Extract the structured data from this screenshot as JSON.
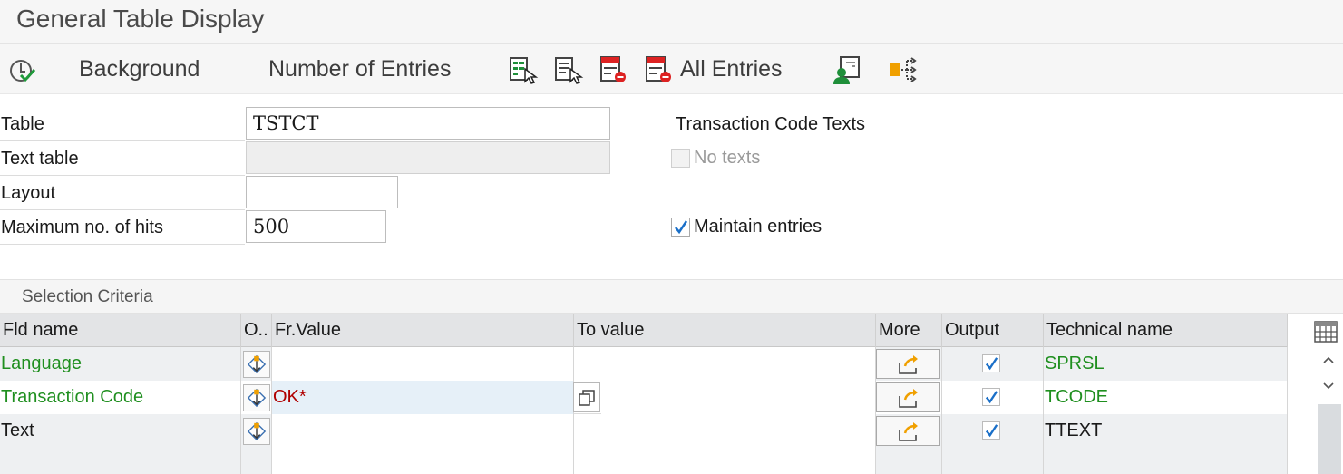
{
  "window": {
    "title": "General Table Display"
  },
  "toolbar": {
    "background_label": "Background",
    "number_of_entries_label": "Number of Entries",
    "all_entries_label": "All Entries"
  },
  "form": {
    "table_label": "Table",
    "table_value": "TSTCT",
    "text_table_label": "Text table",
    "text_table_value": "",
    "layout_label": "Layout",
    "layout_value": "",
    "max_hits_label": "Maximum no. of hits",
    "max_hits_value": "500",
    "section_title": "Transaction Code Texts",
    "no_texts_label": "No texts",
    "no_texts_checked": false,
    "maintain_entries_label": "Maintain entries",
    "maintain_entries_checked": true
  },
  "selection": {
    "title": "Selection Criteria",
    "columns": [
      "Fld name",
      "O..",
      "Fr.Value",
      "To value",
      "More",
      "Output",
      "Technical name"
    ],
    "rows": [
      {
        "field": "Language",
        "from": "",
        "to": "",
        "output": true,
        "technical": "SPRSL",
        "key": true
      },
      {
        "field": "Transaction Code",
        "from": "OK*",
        "to": "",
        "output": true,
        "technical": "TCODE",
        "key": true
      },
      {
        "field": "Text",
        "from": "",
        "to": "",
        "output": true,
        "technical": "TTEXT",
        "key": false
      }
    ]
  },
  "colors": {
    "key_field": "#1f8f1f",
    "value_red": "#b00000",
    "accent_orange": "#f0a000"
  }
}
